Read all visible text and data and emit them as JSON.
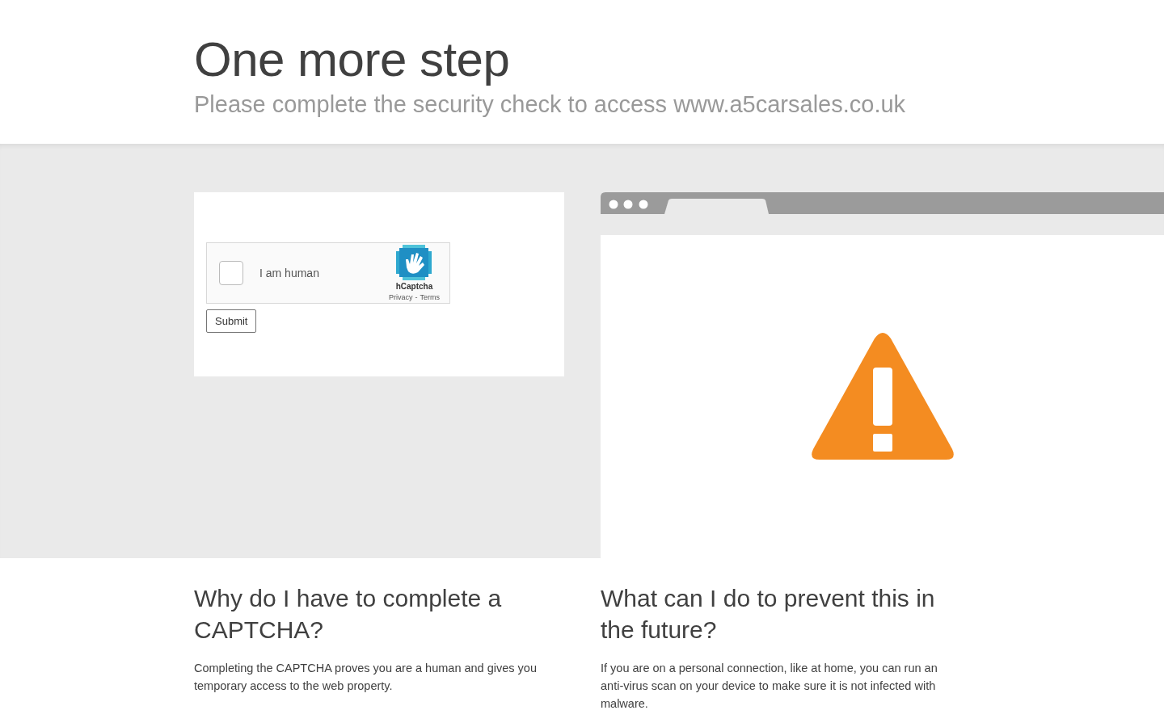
{
  "header": {
    "title": "One more step",
    "subtitle": "Please complete the security check to access www.a5carsales.co.uk"
  },
  "captcha": {
    "label": "I am human",
    "checked": false,
    "brand": "hCaptcha",
    "privacy": "Privacy",
    "separator": "-",
    "terms": "Terms"
  },
  "submit": "Submit",
  "faq": [
    {
      "question": "Why do I have to complete a CAPTCHA?",
      "answer": "Completing the CAPTCHA proves you are a human and gives you temporary access to the web property."
    },
    {
      "question": "What can I do to prevent this in the future?",
      "answer": "If you are on a personal connection, like at home, you can run an anti-virus scan on your device to make sure it is not infected with malware."
    }
  ]
}
